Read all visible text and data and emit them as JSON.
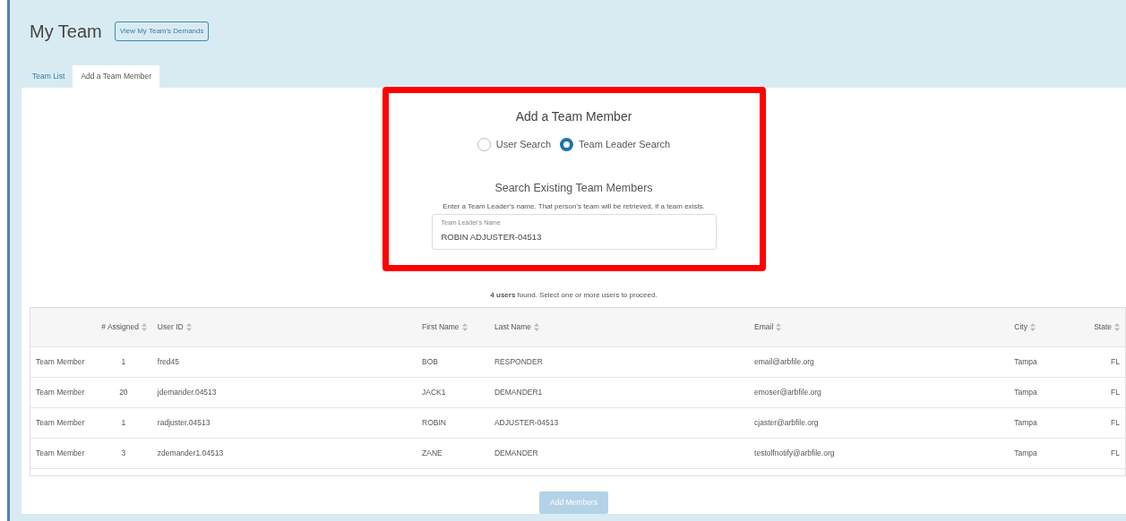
{
  "page": {
    "title": "My Team",
    "header_button": "View My Team's Demands"
  },
  "tabs": [
    {
      "label": "Team List",
      "selected": false
    },
    {
      "label": "Add a Team Member",
      "selected": true
    }
  ],
  "form": {
    "title": "Add a Team Member",
    "search_modes": [
      {
        "label": "User Search",
        "selected": false
      },
      {
        "label": "Team Leader Search",
        "selected": true
      }
    ],
    "subtitle": "Search Existing Team Members",
    "hint": "Enter a Team Leader's name. That person's team will be retrieved, if a team exists.",
    "field": {
      "label": "Team Leader's Name",
      "value": "ROBIN ADJUSTER-04513"
    },
    "highlighted": true
  },
  "result_summary": "**4 users** found. Select one or more users to proceed.",
  "table": {
    "columns": [
      {
        "sortable": false
      },
      {
        "label": "# Assigned",
        "sortable": true
      },
      {
        "label": "User ID",
        "sortable": true
      },
      {
        "label": "First Name",
        "sortable": true
      },
      {
        "label": "Last Name",
        "sortable": true
      },
      {
        "label": "Email",
        "sortable": true
      },
      {
        "label": "City",
        "sortable": true
      },
      {
        "label": "State",
        "sortable": true
      }
    ],
    "rows": [
      [
        "Team Member",
        "1",
        "fred45",
        "BOB",
        "RESPONDER",
        "email@arbfile.org",
        "Tampa",
        "FL"
      ],
      [
        "Team Member",
        "20",
        "jdemander.04513",
        "JACK1",
        "DEMANDER1",
        "emoser@arbfile.org",
        "Tampa",
        "FL"
      ],
      [
        "Team Member",
        "1",
        "radjuster.04513",
        "ROBIN",
        "ADJUSTER-04513",
        "cjaster@arbfile.org",
        "Tampa",
        "FL"
      ],
      [
        "Team Member",
        "3",
        "zdemander1.04513",
        "ZANE",
        "DEMANDER",
        "testolfnotify@arbfile.org",
        "Tampa",
        "FL"
      ]
    ]
  },
  "footer_button": {
    "label": "Add Members",
    "disabled": true
  }
}
